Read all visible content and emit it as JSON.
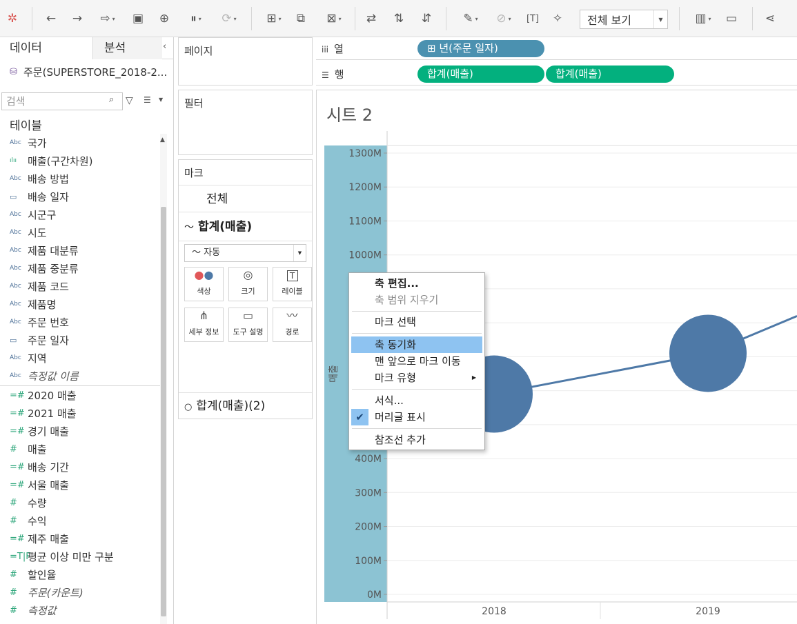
{
  "toolbar": {
    "view_mode": "전체 보기",
    "icons": [
      "tableau-logo-icon",
      "undo-icon",
      "redo-icon",
      "replay-icon",
      "save-icon",
      "new-datasource-icon",
      "pause-icon",
      "refresh-icon",
      "new-sheet-icon",
      "duplicate-sheet-icon",
      "clear-sheet-icon",
      "swap-icon",
      "sort-ascending-icon",
      "sort-descending-icon",
      "highlight-icon",
      "group-icon",
      "labels-icon",
      "pin-icon",
      "show-me-icon",
      "presentation-icon",
      "share-icon"
    ]
  },
  "data_pane": {
    "tab_data": "데이터",
    "tab_analysis": "분석",
    "datasource": "주문(SUPERSTORE_2018-2...",
    "search_placeholder": "검색",
    "tables_label": "테이블",
    "fields": [
      {
        "icon": "Abc",
        "name": "국가",
        "kind": "dim"
      },
      {
        "icon": "ılıı",
        "name": "매출(구간차원)",
        "kind": "bin"
      },
      {
        "icon": "Abc",
        "name": "배송 방법",
        "kind": "dim"
      },
      {
        "icon": "▭",
        "name": "배송 일자",
        "kind": "date"
      },
      {
        "icon": "Abc",
        "name": "시군구",
        "kind": "dim"
      },
      {
        "icon": "Abc",
        "name": "시도",
        "kind": "dim"
      },
      {
        "icon": "Abc",
        "name": "제품 대분류",
        "kind": "dim"
      },
      {
        "icon": "Abc",
        "name": "제품 중분류",
        "kind": "dim"
      },
      {
        "icon": "Abc",
        "name": "제품 코드",
        "kind": "dim"
      },
      {
        "icon": "Abc",
        "name": "제품명",
        "kind": "dim"
      },
      {
        "icon": "Abc",
        "name": "주문 번호",
        "kind": "dim"
      },
      {
        "icon": "▭",
        "name": "주문 일자",
        "kind": "date"
      },
      {
        "icon": "Abc",
        "name": "지역",
        "kind": "dim"
      },
      {
        "icon": "Abc",
        "name": "측정값 이름",
        "kind": "dim",
        "italic": true
      },
      {
        "icon": "=#",
        "name": "2020 매출",
        "kind": "msr"
      },
      {
        "icon": "=#",
        "name": "2021 매출",
        "kind": "msr"
      },
      {
        "icon": "=#",
        "name": "경기 매출",
        "kind": "msr"
      },
      {
        "icon": "#",
        "name": "매출",
        "kind": "msr"
      },
      {
        "icon": "=#",
        "name": "배송 기간",
        "kind": "msr"
      },
      {
        "icon": "=#",
        "name": "서울 매출",
        "kind": "msr"
      },
      {
        "icon": "#",
        "name": "수량",
        "kind": "msr"
      },
      {
        "icon": "#",
        "name": "수익",
        "kind": "msr"
      },
      {
        "icon": "=#",
        "name": "제주 매출",
        "kind": "msr"
      },
      {
        "icon": "=T|F",
        "name": "평균 이상 미만 구분",
        "kind": "msr"
      },
      {
        "icon": "#",
        "name": "할인율",
        "kind": "msr"
      },
      {
        "icon": "#",
        "name": "주문(카운트)",
        "kind": "msr",
        "italic": true
      },
      {
        "icon": "#",
        "name": "측정값",
        "kind": "msr",
        "italic": true
      }
    ]
  },
  "shelves": {
    "pages": "페이지",
    "filters": "필터",
    "columns_label": "열",
    "rows_label": "행",
    "column_pill": "⊞ 년(주문 일자)",
    "row_pills": [
      "합계(매출)",
      "합계(매출)"
    ]
  },
  "marks": {
    "title": "마크",
    "all": "전체",
    "sum1": "합계(매출)",
    "mark_type": "자동",
    "buttons": [
      {
        "label": "색상",
        "icon": "color-icon"
      },
      {
        "label": "크기",
        "icon": "size-icon"
      },
      {
        "label": "레이블",
        "icon": "label-icon"
      },
      {
        "label": "세부 정보",
        "icon": "detail-icon"
      },
      {
        "label": "도구 설명",
        "icon": "tooltip-icon"
      },
      {
        "label": "경로",
        "icon": "path-icon"
      }
    ],
    "sum2": "합계(매출)(2)"
  },
  "view": {
    "sheet_title": "시트 2",
    "axis_title": "매출"
  },
  "chart_data": {
    "type": "line",
    "x": [
      "2018",
      "2019"
    ],
    "ylim": [
      0,
      1300
    ],
    "yticks": [
      "0M",
      "100M",
      "200M",
      "300M",
      "400M",
      "500M",
      "600M",
      "700M",
      "800M",
      "900M",
      "1000M",
      "1100M",
      "1200M",
      "1300M"
    ],
    "series": [
      {
        "values": [
          590,
          710
        ]
      }
    ],
    "circle_series": [
      {
        "values": [
          590,
          710
        ]
      }
    ],
    "grid": true
  },
  "context_menu": {
    "items": [
      {
        "label": "축 편집...",
        "style": "bold"
      },
      {
        "label": "축 범위 지우기",
        "style": "disabled"
      },
      {
        "label": "마크 선택",
        "style": "normal"
      },
      {
        "label": "축 동기화",
        "style": "highlight"
      },
      {
        "label": "맨 앞으로 마크 이동",
        "style": "normal"
      },
      {
        "label": "마크 유형",
        "style": "submenu"
      },
      {
        "label": "서식...",
        "style": "normal"
      },
      {
        "label": "머리글 표시",
        "style": "checked"
      },
      {
        "label": "참조선 추가",
        "style": "normal"
      }
    ]
  }
}
